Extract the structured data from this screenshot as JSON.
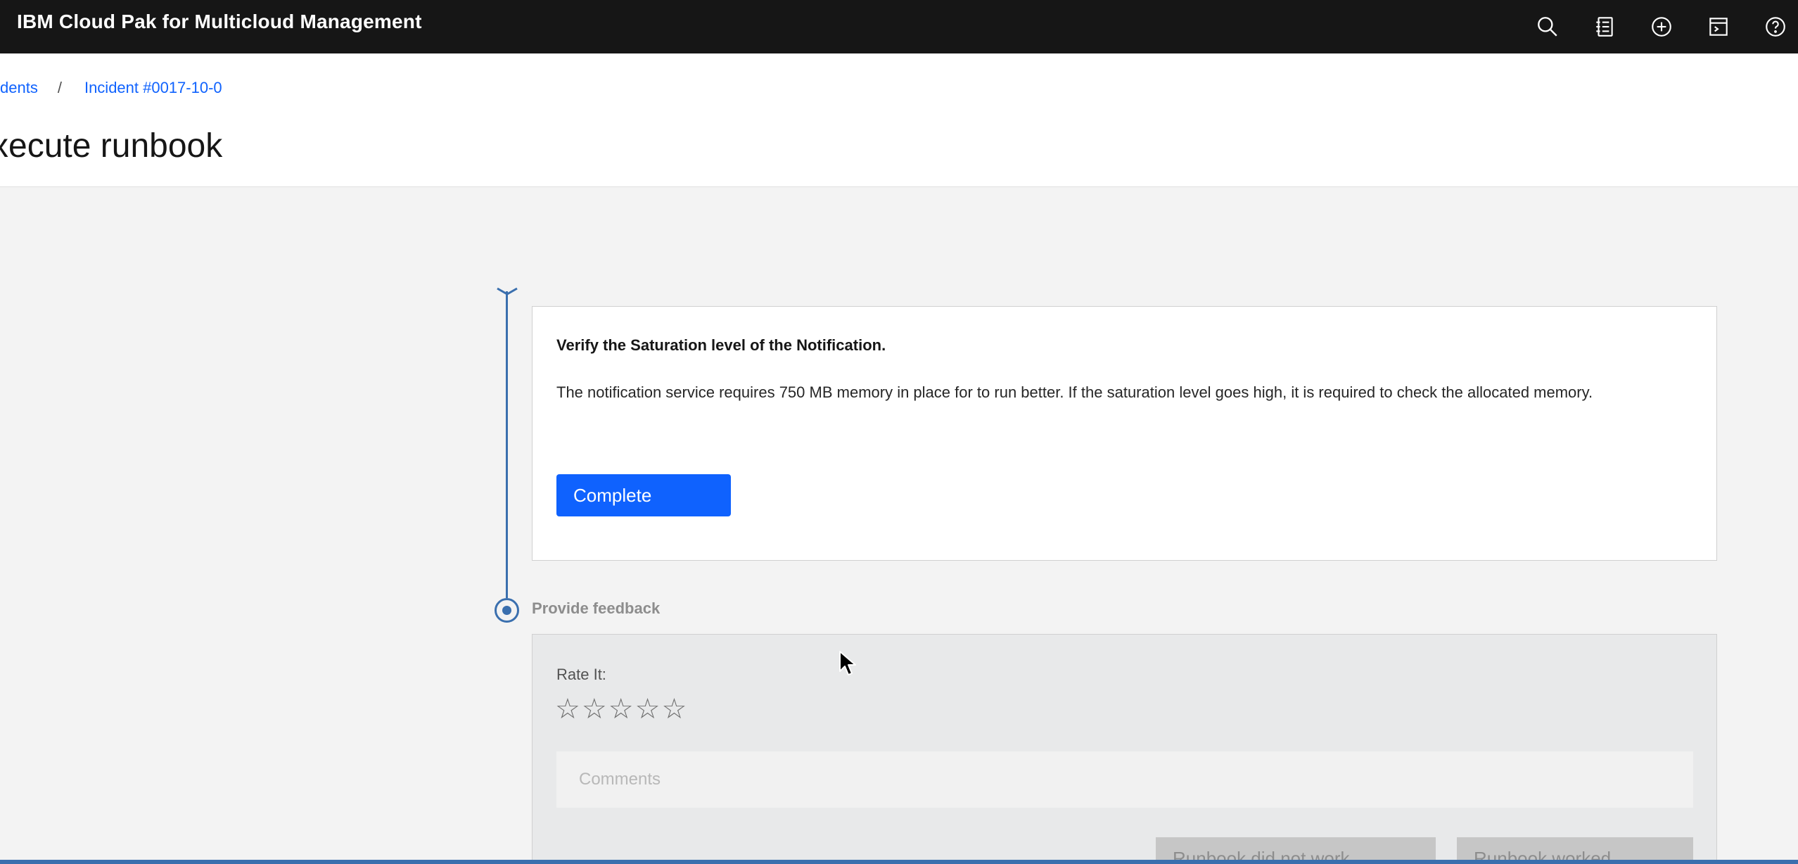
{
  "app": {
    "title": "IBM Cloud Pak for Multicloud Management",
    "header_icons": [
      "search-icon",
      "catalog-icon",
      "add-icon",
      "terminal-icon",
      "help-icon"
    ]
  },
  "breadcrumb": {
    "parent": "dents",
    "separator": "/",
    "current": "Incident #0017-10-0"
  },
  "page": {
    "title": "xecute runbook"
  },
  "step": {
    "title": "Verify the Saturation level of the Notification.",
    "description": "The notification service requires 750 MB memory in place for to run better. If the saturation level goes high, it is required to check the allocated memory.",
    "complete_label": "Complete"
  },
  "feedback": {
    "label": "Provide feedback",
    "rate_label": "Rate It:",
    "rating": 0,
    "max_rating": 5,
    "comments_placeholder": "Comments",
    "did_not_work_label": "Runbook did not work",
    "worked_label": "Runbook worked"
  },
  "colors": {
    "header_bg": "#161616",
    "primary": "#0f62fe",
    "timeline": "#3a6fae",
    "disabled_button": "#c6c6c6"
  }
}
